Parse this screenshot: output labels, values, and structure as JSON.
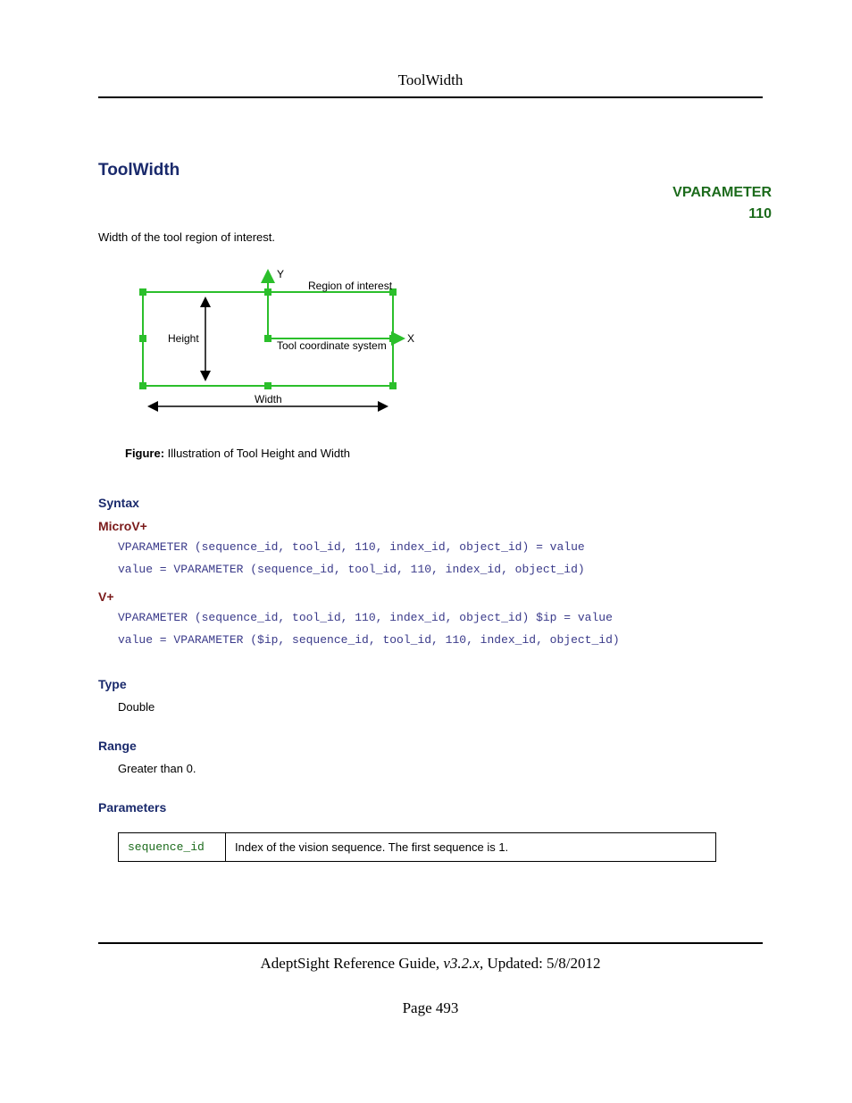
{
  "header": {
    "title": "ToolWidth"
  },
  "page_title": "ToolWidth",
  "vparameter": {
    "label": "VPARAMETER",
    "number": "110"
  },
  "description": "Width of the tool region of interest.",
  "figure": {
    "y_label": "Y",
    "x_label": "X",
    "roi_label": "Region of interest",
    "height_label": "Height",
    "width_label": "Width",
    "tool_label": "Tool coordinate system",
    "caption_prefix": "Figure:",
    "caption_text": " Illustration of Tool Height and Width"
  },
  "syntax": {
    "heading": "Syntax",
    "microv": {
      "heading": "MicroV+",
      "line1": "VPARAMETER (sequence_id, tool_id, 110, index_id, object_id) = value",
      "line2": "value = VPARAMETER (sequence_id, tool_id, 110, index_id, object_id)"
    },
    "vplus": {
      "heading": "V+",
      "line1": "VPARAMETER (sequence_id, tool_id, 110, index_id, object_id) $ip = value",
      "line2": "value = VPARAMETER ($ip, sequence_id, tool_id, 110, index_id, object_id)"
    }
  },
  "type": {
    "heading": "Type",
    "value": "Double"
  },
  "range": {
    "heading": "Range",
    "value": "Greater than 0."
  },
  "parameters": {
    "heading": "Parameters",
    "rows": [
      {
        "name": "sequence_id",
        "desc": "Index of the vision sequence. The first sequence is 1."
      }
    ]
  },
  "footer": {
    "guide": "AdeptSight Reference Guide",
    "version": ", v3.2.x",
    "updated": ", Updated: 5/8/2012",
    "page_label": "Page 493"
  }
}
